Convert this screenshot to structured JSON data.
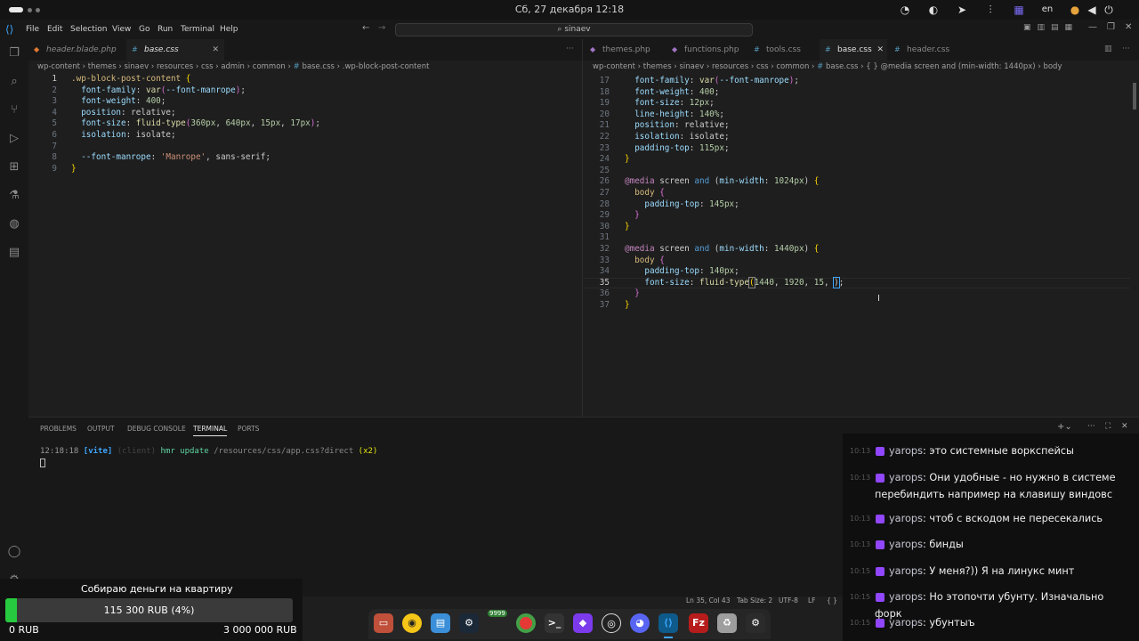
{
  "system_bar": {
    "datetime": "Сб, 27 декабря  12:18",
    "language": "en",
    "tray_icons": [
      "opera-icon",
      "ring-icon",
      "telegram-icon",
      "equalizer-icon",
      "network-icon",
      "language-indicator",
      "microphone-icon",
      "volume-icon",
      "power-icon"
    ]
  },
  "menu": [
    "File",
    "Edit",
    "Selection",
    "View",
    "Go",
    "Run",
    "Terminal",
    "Help"
  ],
  "command_center": "sinaev",
  "left_editor": {
    "tabs": [
      {
        "label": "header.blade.php",
        "active": false
      },
      {
        "label": "base.css",
        "active": true
      }
    ],
    "breadcrumb": [
      "wp-content",
      "themes",
      "sinaev",
      "resources",
      "css",
      "admin",
      "common",
      "base.css",
      ".wp-block-post-content"
    ],
    "line_numbers": [
      "1",
      "2",
      "3",
      "4",
      "5",
      "6",
      "7",
      "8",
      "9"
    ]
  },
  "right_editor": {
    "tabs": [
      {
        "label": "themes.php",
        "active": false
      },
      {
        "label": "functions.php",
        "active": false
      },
      {
        "label": "tools.css",
        "active": false
      },
      {
        "label": "base.css",
        "active": true
      },
      {
        "label": "header.css",
        "active": false
      }
    ],
    "breadcrumb": [
      "wp-content",
      "themes",
      "sinaev",
      "resources",
      "css",
      "common",
      "base.css",
      "{ } @media screen and (min-width: 1440px)",
      "body"
    ],
    "line_numbers": [
      "17",
      "18",
      "19",
      "20",
      "21",
      "22",
      "23",
      "24",
      "25",
      "26",
      "27",
      "28",
      "29",
      "30",
      "31",
      "32",
      "33",
      "34",
      "35",
      "36",
      "37"
    ]
  },
  "panel": {
    "tabs": [
      "PROBLEMS",
      "OUTPUT",
      "DEBUG CONSOLE",
      "TERMINAL",
      "PORTS"
    ],
    "active_tab": "TERMINAL",
    "terminal_line": {
      "time": "12:18:18",
      "tag": "[vite]",
      "client": "(client)",
      "action": "hmr update",
      "path": "/resources/css/app.css?direct",
      "count": "(x2)"
    }
  },
  "status_bar": {
    "position": "Ln 35, Col 43",
    "tab_size": "Tab Size: 2",
    "encoding": "UTF-8",
    "eol": "LF",
    "language": "{ }"
  },
  "chat": [
    {
      "time": "10:13",
      "user": "yarops",
      "text": "это системные воркспейсы"
    },
    {
      "time": "10:13",
      "user": "yarops",
      "text": "Они удобные - но нужно в системе перебиндить например на клавишу виндовс"
    },
    {
      "time": "10:13",
      "user": "yarops",
      "text": "чтоб с вскодом не пересекались"
    },
    {
      "time": "10:13",
      "user": "yarops",
      "text": "бинды"
    },
    {
      "time": "10:15",
      "user": "yarops",
      "text": "У меня?)) Я на линукс минт"
    },
    {
      "time": "10:15",
      "user": "yarops",
      "text": "Но этопочти убунту. Изначально форк"
    },
    {
      "time": "10:15",
      "user": "yarops",
      "text": "убунтыъ"
    }
  ],
  "donation": {
    "title": "Собираю деньги на квартиру",
    "progress_text": "115 300 RUB (4%)",
    "progress_fraction": 0.04,
    "min": "0 RUB",
    "max": "3 000 000 RUB",
    "fill_color": "#27c93f"
  },
  "dock": {
    "apps": [
      "files",
      "rhythmbox",
      "text-editor",
      "steam",
      "chrome",
      "terminal",
      "obsidian",
      "obs",
      "discord",
      "vscode",
      "filezilla",
      "trash",
      "settings"
    ],
    "steam_badge": "9999"
  }
}
